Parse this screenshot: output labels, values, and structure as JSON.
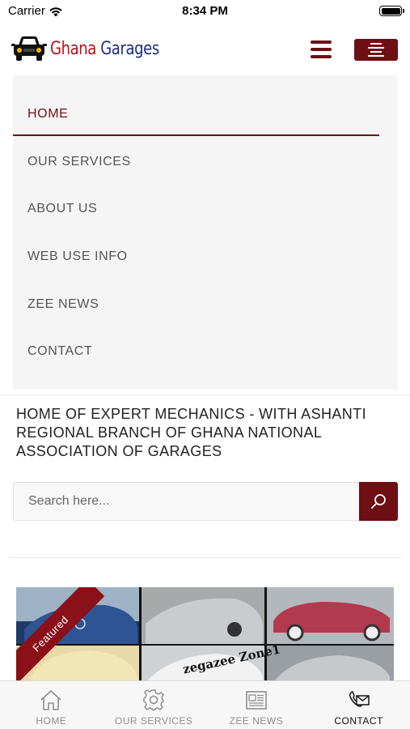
{
  "status_bar": {
    "carrier": "Carrier",
    "time": "8:34 PM"
  },
  "header": {
    "logo_word1": "Ghana",
    "logo_word2": "Garages",
    "brand_color": "#6e0f14",
    "logo_red": "#b3141b",
    "logo_blue": "#1f2f7a"
  },
  "nav": {
    "items": [
      {
        "label": "HOME",
        "active": true
      },
      {
        "label": "OUR SERVICES",
        "active": false
      },
      {
        "label": "ABOUT US",
        "active": false
      },
      {
        "label": "WEB USE INFO",
        "active": false
      },
      {
        "label": "ZEE NEWS",
        "active": false
      },
      {
        "label": "CONTACT",
        "active": false
      }
    ]
  },
  "tagline": "HOME OF EXPERT MECHANICS - WITH ASHANTI REGIONAL BRANCH OF GHANA NATIONAL ASSOCIATION OF GARAGES",
  "search": {
    "placeholder": "Search here...",
    "icon": "search-icon"
  },
  "featured": {
    "ribbon": "Featured",
    "watermark": "zegazee Zone1"
  },
  "tabbar": {
    "tabs": [
      {
        "label": "HOME",
        "icon": "home-icon",
        "active": false
      },
      {
        "label": "OUR SERVICES",
        "icon": "gear-icon",
        "active": false
      },
      {
        "label": "ZEE NEWS",
        "icon": "newspaper-icon",
        "active": false
      },
      {
        "label": "CONTACT",
        "icon": "phone-mail-icon",
        "active": true
      }
    ]
  }
}
